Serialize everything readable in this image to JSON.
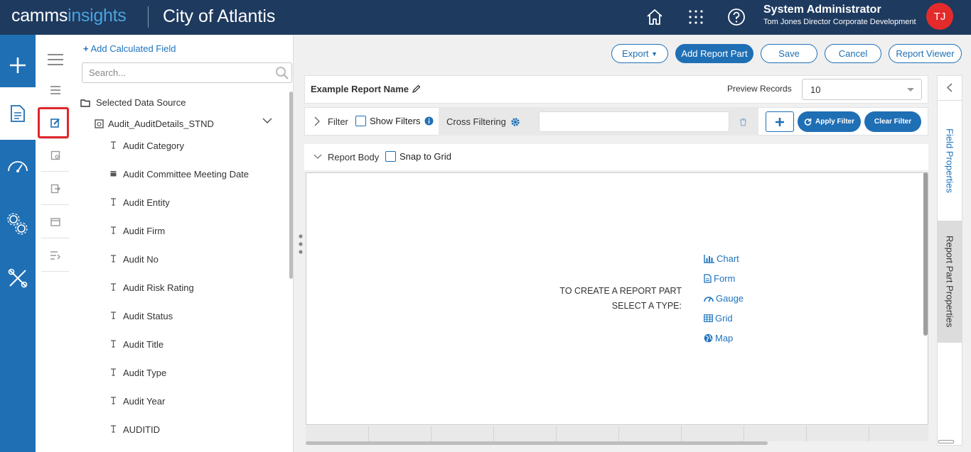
{
  "header": {
    "logo_part1": "camms",
    "logo_part2": "insights",
    "app_title": "City of Atlantis",
    "icons": [
      "home-icon",
      "apps-grid-icon",
      "help-icon"
    ],
    "user_name": "System Administrator",
    "user_role": "Tom Jones Director Corporate Development",
    "avatar_initials": "TJ"
  },
  "rail": {
    "items": [
      "plus-icon",
      "report-icon",
      "dashboard-gauge-icon",
      "settings-gears-icon",
      "tools-icon"
    ]
  },
  "secondary_rail": {
    "items": [
      "hamburger-menu-icon",
      "list-icon",
      "edit-report-icon",
      "report-preview-icon",
      "export-icon",
      "calendar-icon",
      "sort-list-icon"
    ],
    "active_item": "edit-report-icon"
  },
  "fields_panel": {
    "add_calc_label": "Add Calculated Field",
    "search_placeholder": "Search...",
    "data_source_label": "Selected Data Source",
    "table_name": "Audit_AuditDetails_STND",
    "fields": [
      {
        "label": "Audit Category",
        "type": "text"
      },
      {
        "label": "Audit Committee Meeting Date",
        "type": "date"
      },
      {
        "label": "Audit Entity",
        "type": "text"
      },
      {
        "label": "Audit Firm",
        "type": "text"
      },
      {
        "label": "Audit No",
        "type": "text"
      },
      {
        "label": "Audit Risk Rating",
        "type": "text"
      },
      {
        "label": "Audit Status",
        "type": "text"
      },
      {
        "label": "Audit Title",
        "type": "text"
      },
      {
        "label": "Audit Type",
        "type": "text"
      },
      {
        "label": "Audit Year",
        "type": "text"
      },
      {
        "label": "AUDITID",
        "type": "text"
      }
    ]
  },
  "toolbar": {
    "export_label": "Export",
    "add_part_label": "Add Report Part",
    "save_label": "Save",
    "cancel_label": "Cancel",
    "viewer_label": "Report Viewer"
  },
  "report": {
    "name": "Example Report Name",
    "preview_label": "Preview Records",
    "preview_value": "10"
  },
  "filter": {
    "label": "Filter",
    "show_filters_label": "Show Filters",
    "cross_filtering_label": "Cross Filtering",
    "apply_label": "Apply Filter",
    "clear_label": "Clear Filter"
  },
  "report_body": {
    "label": "Report Body",
    "snap_label": "Snap to Grid",
    "create_line1": "TO CREATE A REPORT PART",
    "create_line2": "SELECT A TYPE:",
    "types": [
      "Chart",
      "Form",
      "Gauge",
      "Grid",
      "Map"
    ]
  },
  "right_panel": {
    "tab1": "Field Properties",
    "tab2": "Report Part Properties"
  },
  "colors": {
    "header_bg": "#1e3a5f",
    "rail_bg": "#1f6fb5",
    "accent": "#1e73be",
    "avatar_bg": "#e32b2b",
    "highlight": "#e0262b"
  }
}
